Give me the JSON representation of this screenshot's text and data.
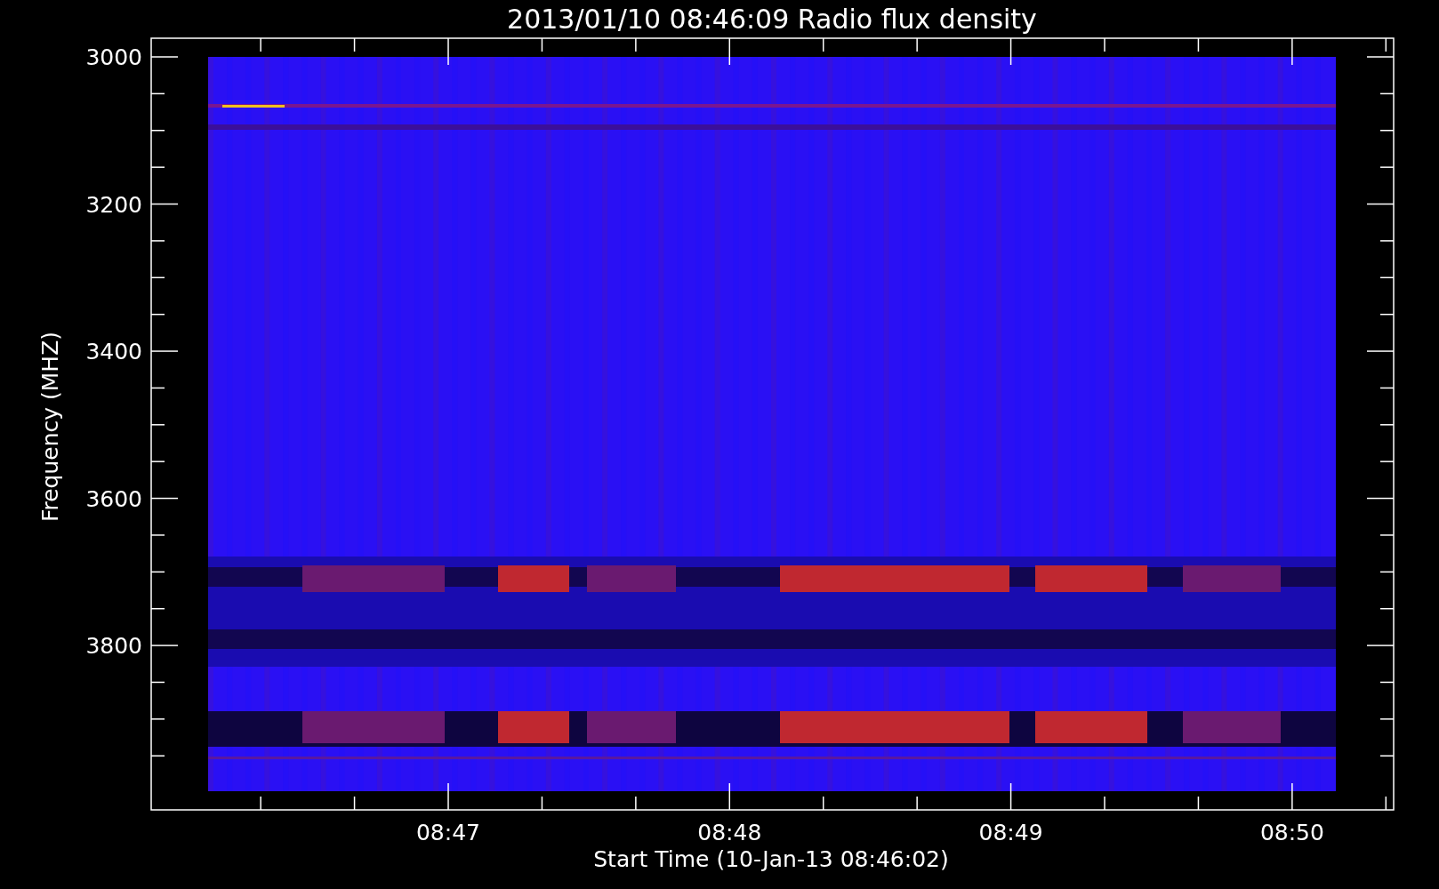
{
  "title": "2013/01/10 08:46:09 Radio flux density",
  "xlabel": "Start Time (10-Jan-13 08:46:02)",
  "ylabel": "Frequency (MHZ)",
  "yticks": [
    "3000",
    "3200",
    "3400",
    "3600",
    "3800"
  ],
  "xticks": [
    "08:47",
    "08:48",
    "08:49",
    "08:50"
  ]
}
